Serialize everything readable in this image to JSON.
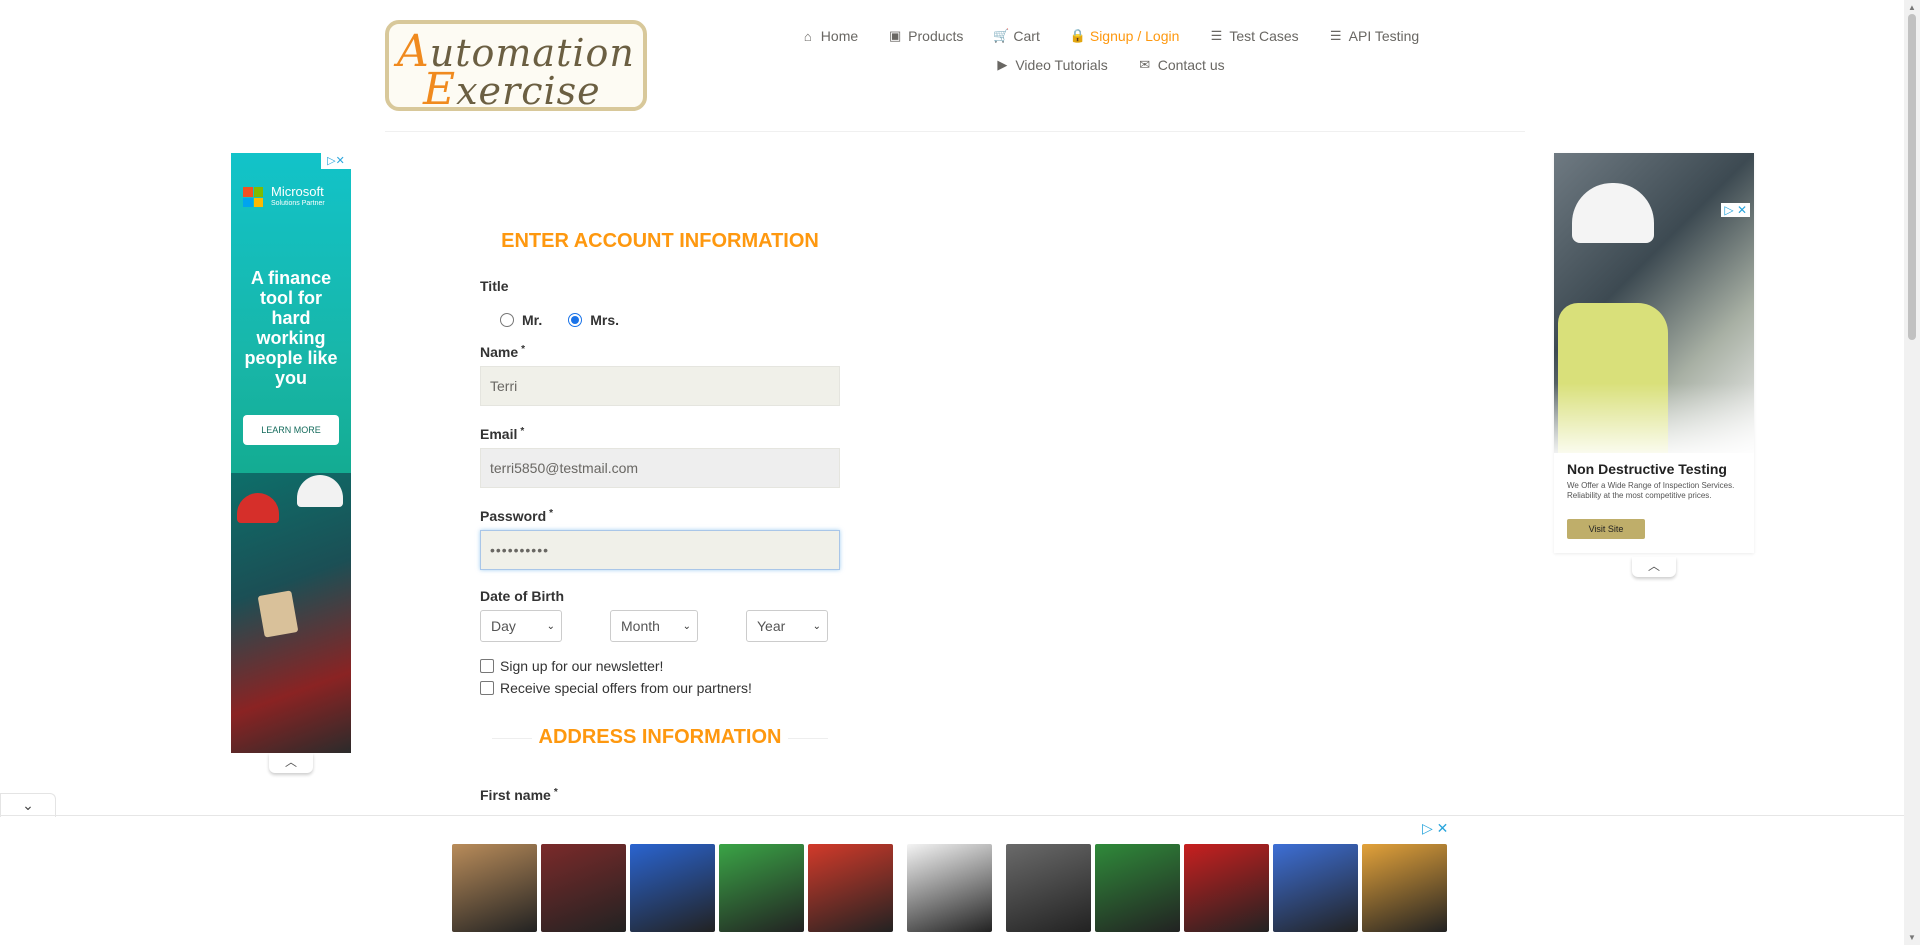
{
  "logo": {
    "line1_big": "A",
    "line1_rest": "utomation",
    "line2_big": "E",
    "line2_rest": "xercise"
  },
  "nav": {
    "row1": [
      {
        "label": "Home",
        "icon": "home-icon",
        "glyph": "⌂"
      },
      {
        "label": "Products",
        "icon": "products-icon",
        "glyph": "▣"
      },
      {
        "label": "Cart",
        "icon": "cart-icon",
        "glyph": "🛒"
      },
      {
        "label": "Signup / Login",
        "icon": "lock-icon",
        "glyph": "🔒",
        "active": true
      },
      {
        "label": "Test Cases",
        "icon": "list-icon",
        "glyph": "☰"
      },
      {
        "label": "API Testing",
        "icon": "list-icon",
        "glyph": "☰"
      }
    ],
    "row2": [
      {
        "label": "Video Tutorials",
        "icon": "youtube-icon",
        "glyph": "▶"
      },
      {
        "label": "Contact us",
        "icon": "envelope-icon",
        "glyph": "✉"
      }
    ],
    "active_color": "#fe980f"
  },
  "ad_left": {
    "brand": "Microsoft",
    "brand_sub": "Solutions Partner",
    "headline": "A finance tool for hard working people like you",
    "cta": "LEARN MORE"
  },
  "ad_right": {
    "title": "Non Destructive Testing",
    "subtitle": "We Offer a Wide Range of Inspection Services. Reliability at the most competitive prices.",
    "cta": "Visit Site"
  },
  "form": {
    "heading": "ENTER ACCOUNT INFORMATION",
    "title_label": "Title",
    "title_options": [
      {
        "label": "Mr.",
        "checked": false
      },
      {
        "label": "Mrs.",
        "checked": true
      }
    ],
    "name_label": "Name",
    "name_value": "Terri",
    "email_label": "Email",
    "email_value": "terri5850@testmail.com",
    "password_label": "Password",
    "password_value": "••••••••••",
    "dob_label": "Date of Birth",
    "dob_day": "Day",
    "dob_month": "Month",
    "dob_year": "Year",
    "newsletter_label": "Sign up for our newsletter!",
    "offers_label": "Receive special offers from our partners!",
    "address_heading": "ADDRESS INFORMATION",
    "first_name_label": "First name",
    "required_mark": "*"
  },
  "bottom_ad": {
    "adchoices": "▷ ✕",
    "collapse": "⌄",
    "game_colors": [
      "#b98c5a",
      "#7b2a2a",
      "#2a64d0",
      "#3aa446",
      "#d23a2a",
      "#f4f4f4",
      "#6a6a6a",
      "#2f8a3a",
      "#c81f1f",
      "#3d6fd6",
      "#e3a23a"
    ]
  }
}
